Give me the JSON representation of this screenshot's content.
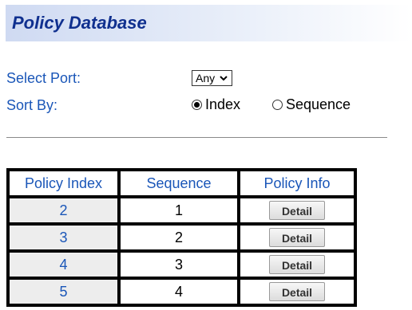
{
  "page": {
    "title": "Policy Database"
  },
  "form": {
    "select_port_label": "Select Port:",
    "select_port_value": "Any",
    "sort_by_label": "Sort By:",
    "sort_options": [
      {
        "label": "Index",
        "checked": true
      },
      {
        "label": "Sequence",
        "checked": false
      }
    ]
  },
  "table": {
    "headers": [
      "Policy Index",
      "Sequence",
      "Policy Info"
    ],
    "rows": [
      {
        "index": "2",
        "sequence": "1",
        "info": "Detail"
      },
      {
        "index": "3",
        "sequence": "2",
        "info": "Detail"
      },
      {
        "index": "4",
        "sequence": "3",
        "info": "Detail"
      },
      {
        "index": "5",
        "sequence": "4",
        "info": "Detail"
      }
    ]
  },
  "colors": {
    "title_text": "#10308f",
    "label_blue": "#1a56b8",
    "index_cell_bg": "#ededed"
  },
  "icons": {
    "select_arrow": "chevron-down-icon",
    "radio": "radio-circle"
  }
}
